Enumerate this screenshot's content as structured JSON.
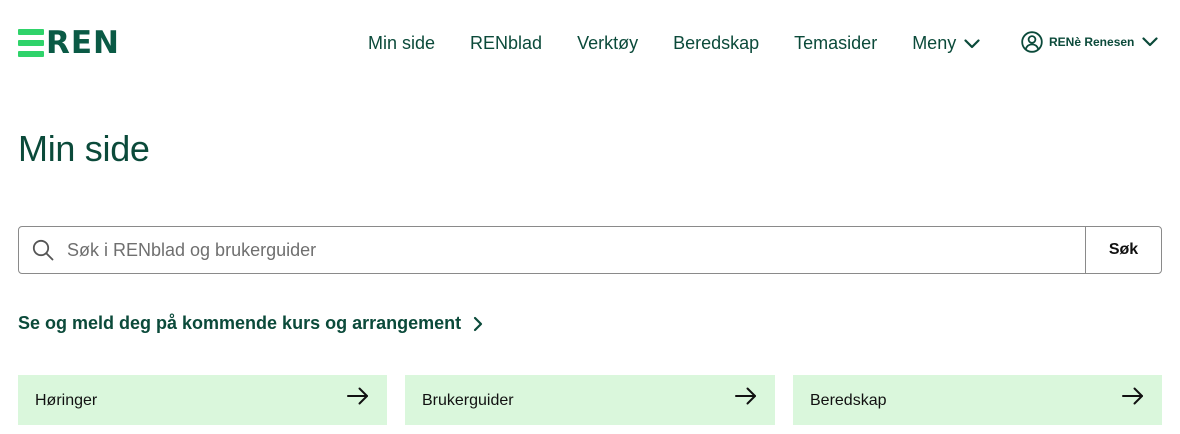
{
  "header": {
    "logo_text": "REN",
    "nav": [
      {
        "label": "Min side"
      },
      {
        "label": "RENblad"
      },
      {
        "label": "Verktøy"
      },
      {
        "label": "Beredskap"
      },
      {
        "label": "Temasider"
      },
      {
        "label": "Meny",
        "icon": "chevron-down-icon"
      }
    ],
    "user": {
      "name": "RENè Renesen",
      "icon": "user-circle-icon"
    }
  },
  "main": {
    "title": "Min side",
    "search": {
      "placeholder": "Søk i RENblad og brukerguider",
      "value": "",
      "button_label": "Søk"
    },
    "events_link": "Se og meld deg på kommende kurs og arrangement",
    "cards": [
      {
        "label": "Høringer"
      },
      {
        "label": "Brukerguider"
      },
      {
        "label": "Beredskap"
      }
    ]
  },
  "colors": {
    "primary_text": "#0b4a3a",
    "logo_green": "#2fd36a",
    "card_bg": "#daf7dc"
  }
}
